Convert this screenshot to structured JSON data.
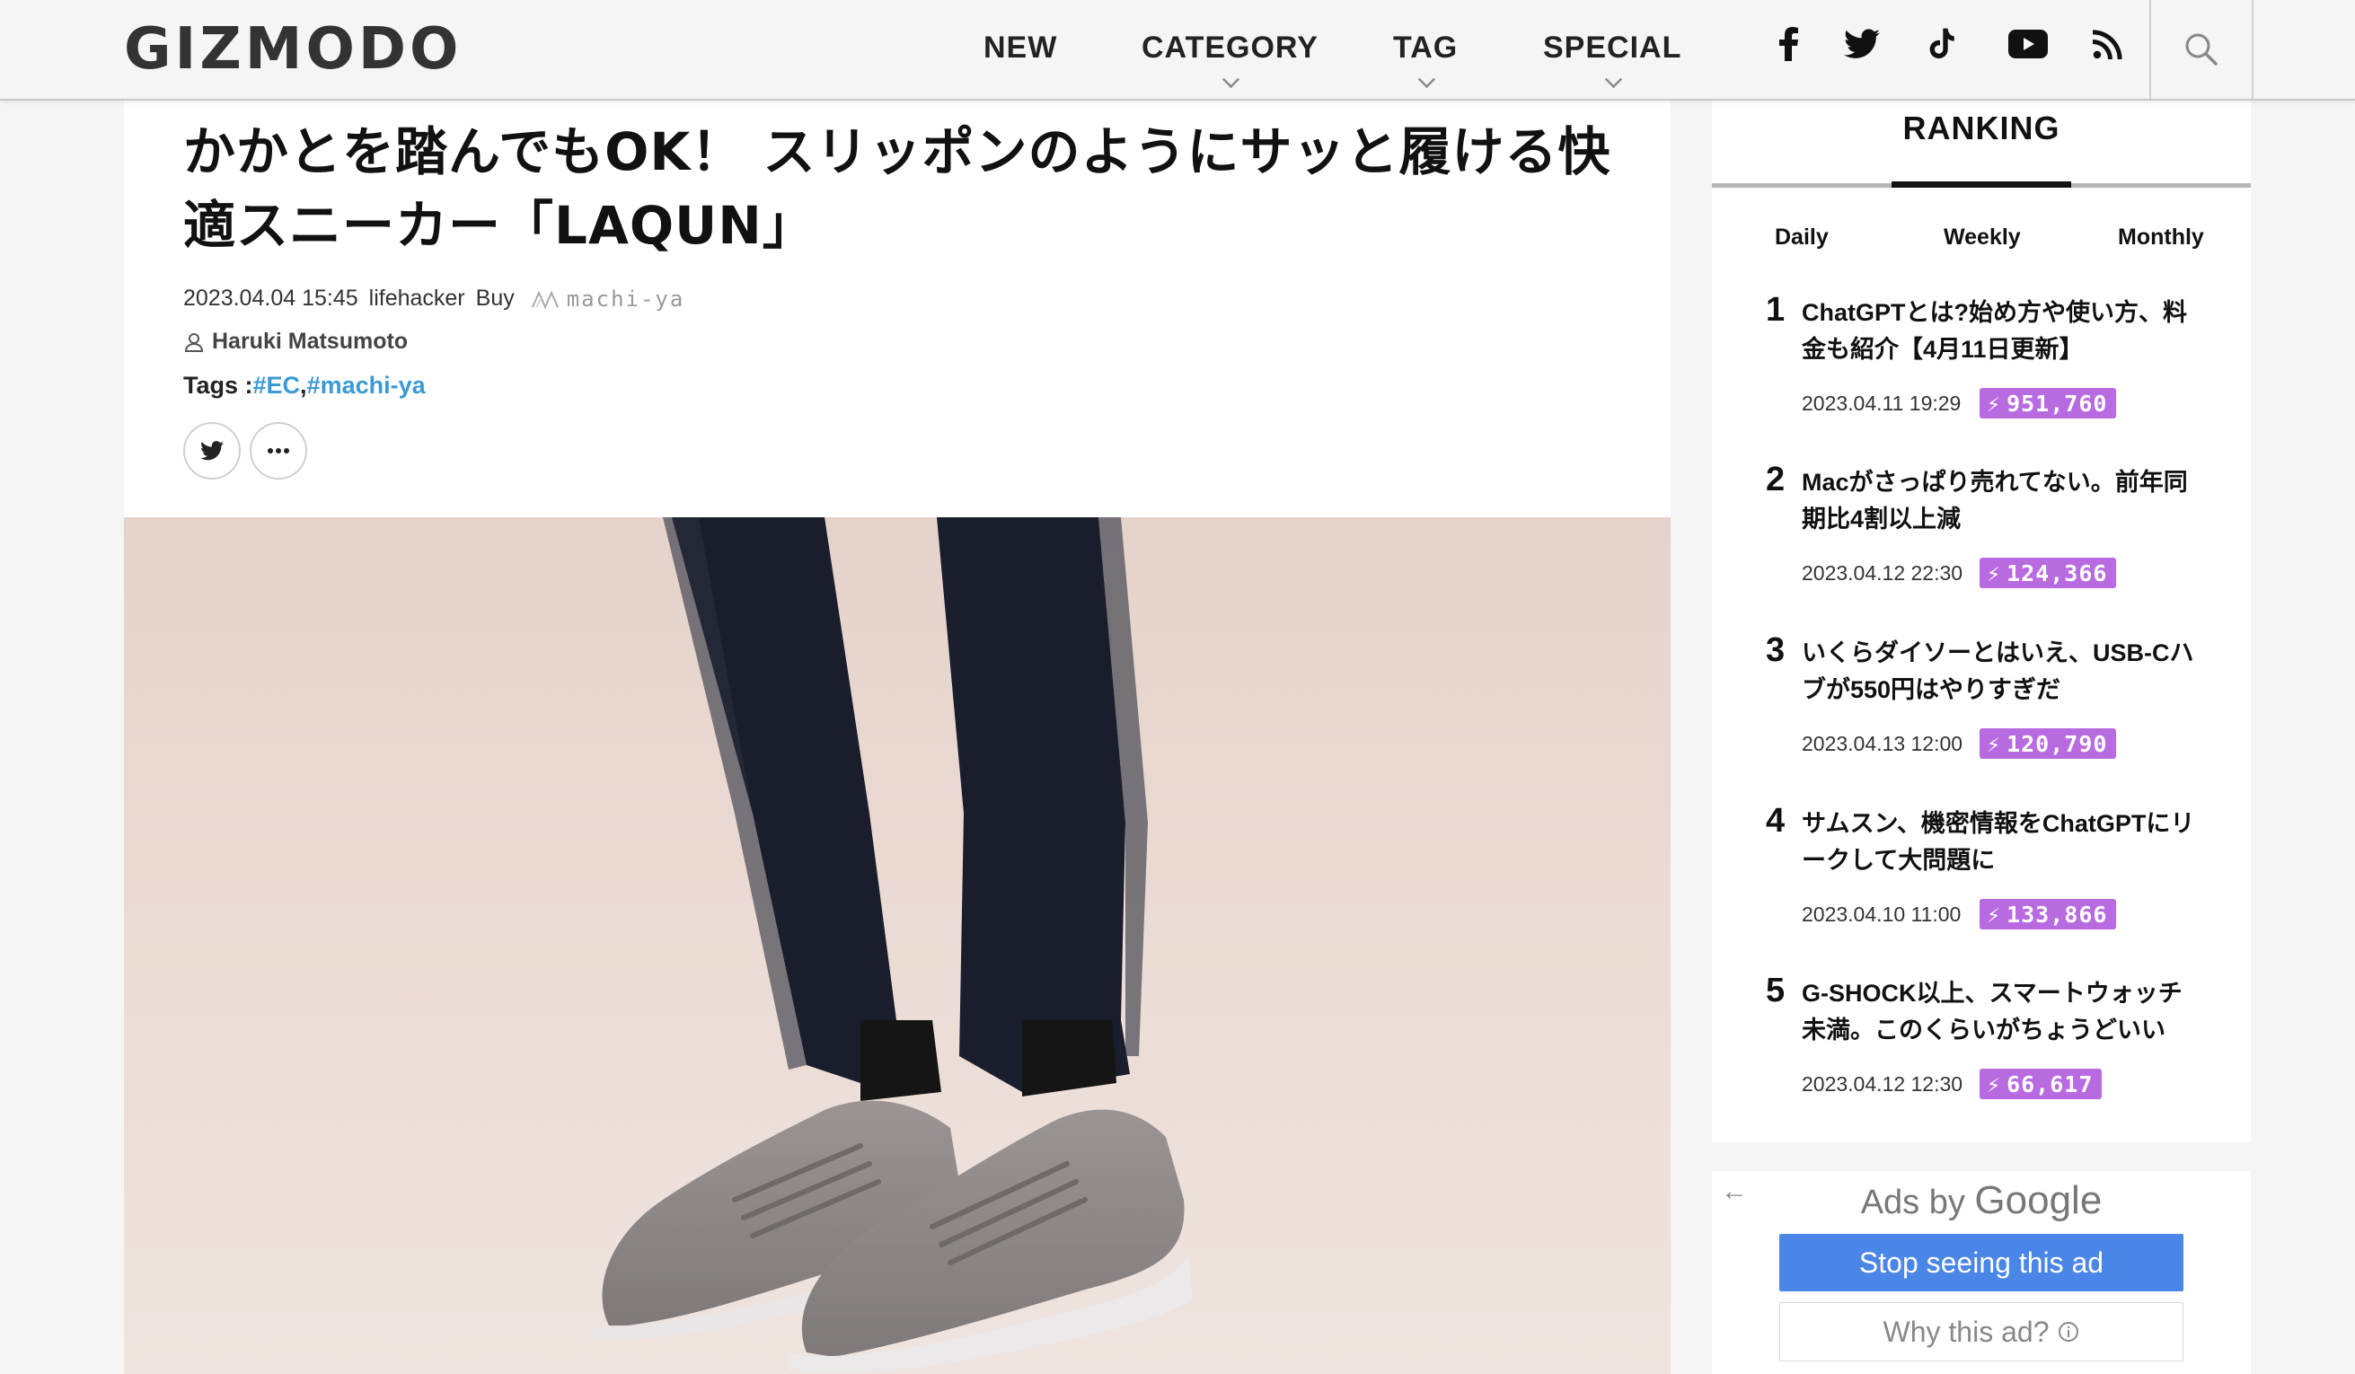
{
  "header": {
    "logo": "GIZMODO",
    "nav": [
      {
        "label": "NEW",
        "dropdown": false
      },
      {
        "label": "CATEGORY",
        "dropdown": true
      },
      {
        "label": "TAG",
        "dropdown": true
      },
      {
        "label": "SPECIAL",
        "dropdown": true
      }
    ],
    "social_icons": [
      "facebook-icon",
      "twitter-icon",
      "tiktok-icon",
      "youtube-icon",
      "rss-icon"
    ],
    "search_icon": "search-icon"
  },
  "article": {
    "title": "かかとを踏んでもOK！ スリッポンのようにサッと履ける快適スニーカー「LAQUN」",
    "datetime": "2023.04.04 15:45",
    "source": "lifehacker",
    "category": "Buy",
    "brand": "machi-ya",
    "author": "Haruki Matsumoto",
    "tags_label": "Tags :",
    "tags": [
      "#EC",
      "#machi-ya"
    ]
  },
  "ranking": {
    "title": "RANKING",
    "tabs": [
      "Daily",
      "Weekly",
      "Monthly"
    ],
    "active_tab": "Weekly",
    "items": [
      {
        "rank": "1",
        "title": "ChatGPTとは?始め方や使い方、料金も紹介【4月11日更新】",
        "date": "2023.04.11 19:29",
        "views": "951,760"
      },
      {
        "rank": "2",
        "title": "Macがさっぱり売れてない。前年同期比4割以上減",
        "date": "2023.04.12 22:30",
        "views": "124,366"
      },
      {
        "rank": "3",
        "title": "いくらダイソーとはいえ、USB-Cハブが550円はやりすぎだ",
        "date": "2023.04.13 12:00",
        "views": "120,790"
      },
      {
        "rank": "4",
        "title": "サムスン、機密情報をChatGPTにリークして大問題に",
        "date": "2023.04.10 11:00",
        "views": "133,866"
      },
      {
        "rank": "5",
        "title": "G-SHOCK以上、スマートウォッチ未満。このくらいがちょうどいい",
        "date": "2023.04.12 12:30",
        "views": "66,617"
      }
    ],
    "badge_color": "#b86be0"
  },
  "ad": {
    "ads_by": "Ads by",
    "google": "Google",
    "stop_label": "Stop seeing this ad",
    "why_label": "Why this ad?",
    "accent": "#4a86e8"
  }
}
